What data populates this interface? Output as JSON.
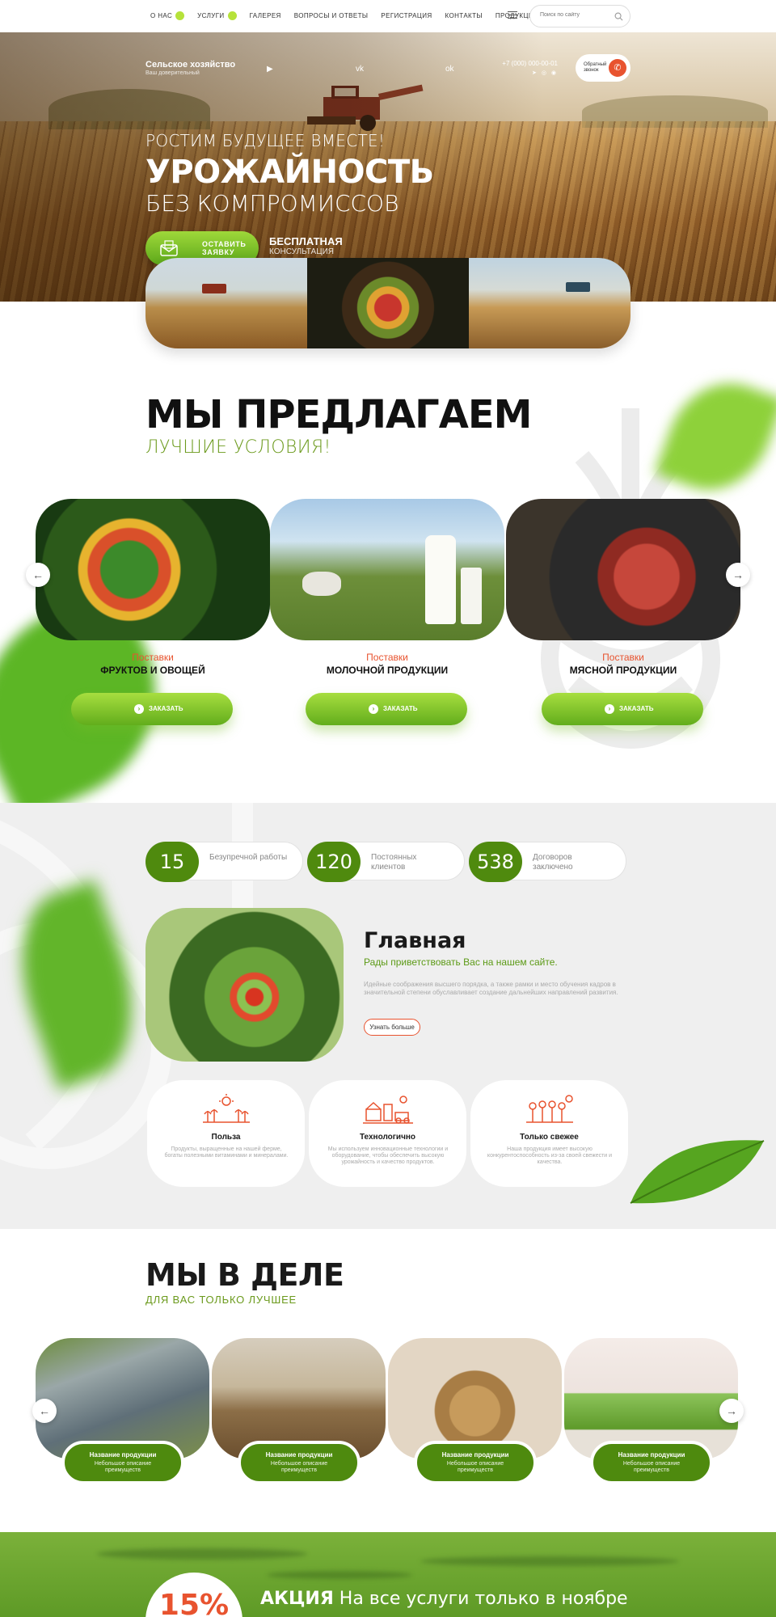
{
  "nav": {
    "items": [
      {
        "label": "О нас",
        "dot": true
      },
      {
        "label": "Услуги",
        "dot": true
      },
      {
        "label": "Галерея",
        "dot": false
      },
      {
        "label": "Вопросы и ответы",
        "dot": false
      },
      {
        "label": "Регистрация",
        "dot": false
      },
      {
        "label": "Контакты",
        "dot": false
      },
      {
        "label": "Продукция",
        "dot": false
      }
    ],
    "search_placeholder": "Поиск по сайту"
  },
  "header": {
    "brand_name": "Сельское хозяйство",
    "brand_sub": "Ваш доверительный",
    "socials": [
      "youtube-icon",
      "vk-icon",
      "ok-icon"
    ],
    "phone": "+7 (000) 000-00-01",
    "messengers": [
      "telegram-icon",
      "whatsapp-icon",
      "viber-icon"
    ],
    "callback_label": "Обратный звонок"
  },
  "hero": {
    "kicker": "РОСТИМ БУДУЩЕЕ ВМЕСТЕ!",
    "title": "УРОЖАЙНОСТЬ",
    "subtitle": "БЕЗ КОМПРОМИССОВ",
    "cta_label": "Оставить заявку",
    "consult_line1": "БЕСПЛАТНАЯ",
    "consult_line2": "КОНСУЛЬТАЦИЯ"
  },
  "offers": {
    "title": "МЫ ПРЕДЛАГАЕМ",
    "subtitle": "ЛУЧШИЕ УСЛОВИЯ!",
    "cards": [
      {
        "kind": "Поставки",
        "name": "фруктов и овощей",
        "button": "Заказать"
      },
      {
        "kind": "Поставки",
        "name": "молочной продукции",
        "button": "Заказать"
      },
      {
        "kind": "Поставки",
        "name": "мясной продукции",
        "button": "Заказать"
      }
    ]
  },
  "stats": [
    {
      "value": "15",
      "label": "Безупречной работы"
    },
    {
      "value": "120",
      "label": "Постоянных клиентов"
    },
    {
      "value": "538",
      "label": "Договоров заключено"
    }
  ],
  "about": {
    "title": "Главная",
    "lead": "Рады приветствовать Вас на нашем сайте.",
    "text": "Идейные соображения высшего порядка, а также рамки и место обучения кадров в значительной степени обуславливает создание дальнейших направлений развития.",
    "more_label": "Узнать больше"
  },
  "features": [
    {
      "title": "Польза",
      "text": "Продукты, выращенные на нашей ферме, богаты полезными витаминами и минералами."
    },
    {
      "title": "Технологично",
      "text": "Мы используем инновационные технологии и оборудование, чтобы обеспечить высокую урожайность и качество продуктов."
    },
    {
      "title": "Только свежее",
      "text": "Наша продукция имеет высокую конкурентоспособность из-за своей свежести и качества."
    }
  ],
  "action": {
    "title": "МЫ В ДЕЛЕ",
    "subtitle": "ДЛЯ ВАС ТОЛЬКО ЛУЧШЕЕ",
    "cards": [
      {
        "title": "Название продукции",
        "desc": "Небольшое описание преимуществ"
      },
      {
        "title": "Название продукции",
        "desc": "Небольшое описание преимуществ"
      },
      {
        "title": "Название продукции",
        "desc": "Небольшое описание преимуществ"
      },
      {
        "title": "Название продукции",
        "desc": "Небольшое описание преимуществ"
      }
    ]
  },
  "promo": {
    "percent": "15%",
    "label": "АКЦИЯ",
    "text": "На все услуги только в ноябре"
  },
  "colors": {
    "accent_green": "#62ad1c",
    "dark_green": "#4f8a0e",
    "accent_orange": "#e8532f"
  }
}
